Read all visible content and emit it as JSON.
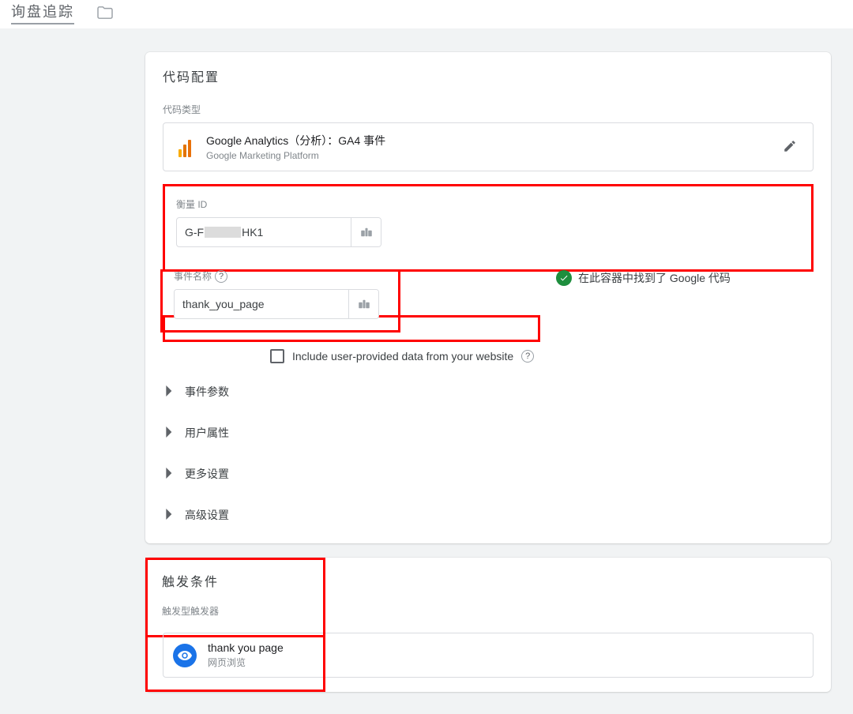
{
  "header": {
    "page_title": "询盘追踪"
  },
  "config": {
    "section_title": "代码配置",
    "tag_type_label": "代码类型",
    "tag_type_title": "Google Analytics（分析）：GA4 事件",
    "tag_type_subtitle": "Google Marketing Platform",
    "measurement_id_label": "衡量 ID",
    "measurement_id_prefix": "G-F",
    "measurement_id_suffix": "HK1",
    "container_found_text": "在此容器中找到了 Google 代码",
    "event_name_label": "事件名称",
    "event_name_value": "thank_you_page",
    "include_user_data_label": "Include user-provided data from your website",
    "accordions": {
      "event_params": "事件参数",
      "user_props": "用户属性",
      "more_settings": "更多设置",
      "advanced_settings": "高级设置"
    }
  },
  "triggers": {
    "section_title": "触发条件",
    "group_label": "触发型触发器",
    "trigger_title": "thank you page",
    "trigger_subtitle": "网页浏览"
  }
}
